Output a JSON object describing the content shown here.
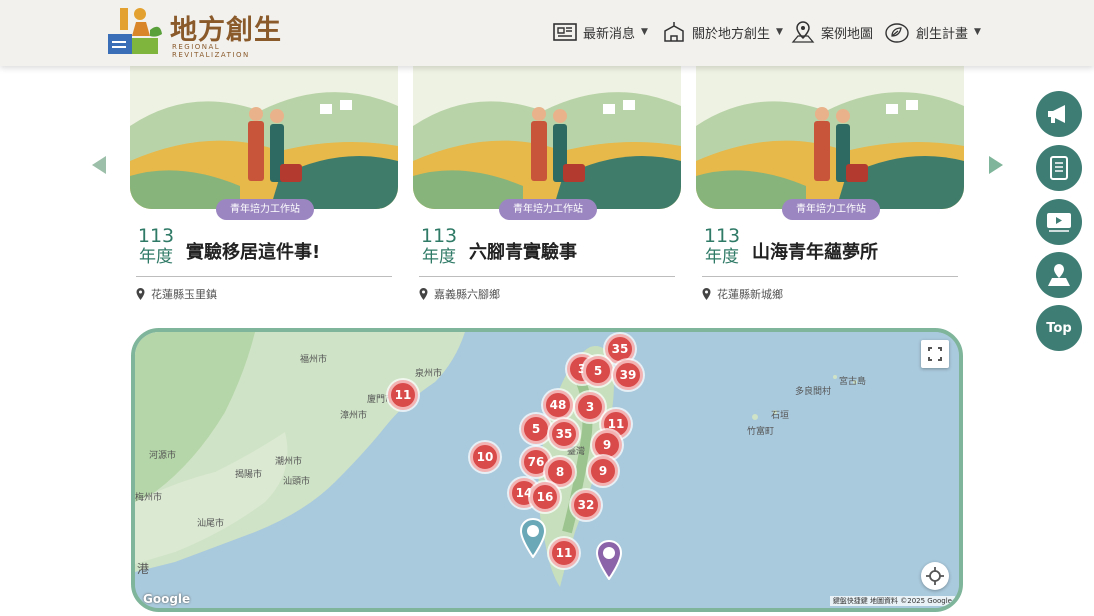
{
  "header": {
    "logo": {
      "title": "地方創生",
      "subtitle": "REGIONAL REVITALIZATION"
    },
    "nav": [
      {
        "label": "最新消息",
        "icon": "news-icon",
        "dropdown": true
      },
      {
        "label": "關於地方創生",
        "icon": "building-icon",
        "dropdown": true
      },
      {
        "label": "案例地圖",
        "icon": "map-pin-icon",
        "dropdown": false
      },
      {
        "label": "創生計畫",
        "icon": "leaf-icon",
        "dropdown": true
      }
    ]
  },
  "cards": [
    {
      "tag": "青年培力工作站",
      "year_num": "113",
      "year_unit": "年度",
      "title": "實驗移居這件事!",
      "location": "花蓮縣玉里鎮"
    },
    {
      "tag": "青年培力工作站",
      "year_num": "113",
      "year_unit": "年度",
      "title": "六腳青實驗事",
      "location": "嘉義縣六腳鄉"
    },
    {
      "tag": "青年培力工作站",
      "year_num": "113",
      "year_unit": "年度",
      "title": "山海青年蘊夢所",
      "location": "花蓮縣新城鄉"
    }
  ],
  "map": {
    "labels": [
      "福州市",
      "泉州市",
      "廈門市",
      "漳州市",
      "河源市",
      "揭陽市",
      "潮州市",
      "汕頭市",
      "梅州市",
      "汕尾市",
      "港",
      "臺灣",
      "竹富町",
      "石垣",
      "宮古島",
      "多良間村"
    ],
    "clusters": [
      "35",
      "3",
      "5",
      "39",
      "11",
      "48",
      "3",
      "11",
      "5",
      "35",
      "9",
      "10",
      "76",
      "8",
      "9",
      "14",
      "16",
      "32",
      "11"
    ],
    "google": "Google",
    "attribution": "鍵盤快捷鍵  地圖資料 ©2025 Google"
  },
  "side_buttons": [
    {
      "icon": "megaphone-icon"
    },
    {
      "icon": "book-icon"
    },
    {
      "icon": "video-icon"
    },
    {
      "icon": "map-icon"
    },
    {
      "label": "Top"
    }
  ],
  "colors": {
    "accent": "#3e7d74",
    "green": "#7fb59a",
    "tag": "#9b86c1",
    "marker": "#d94a4a"
  }
}
